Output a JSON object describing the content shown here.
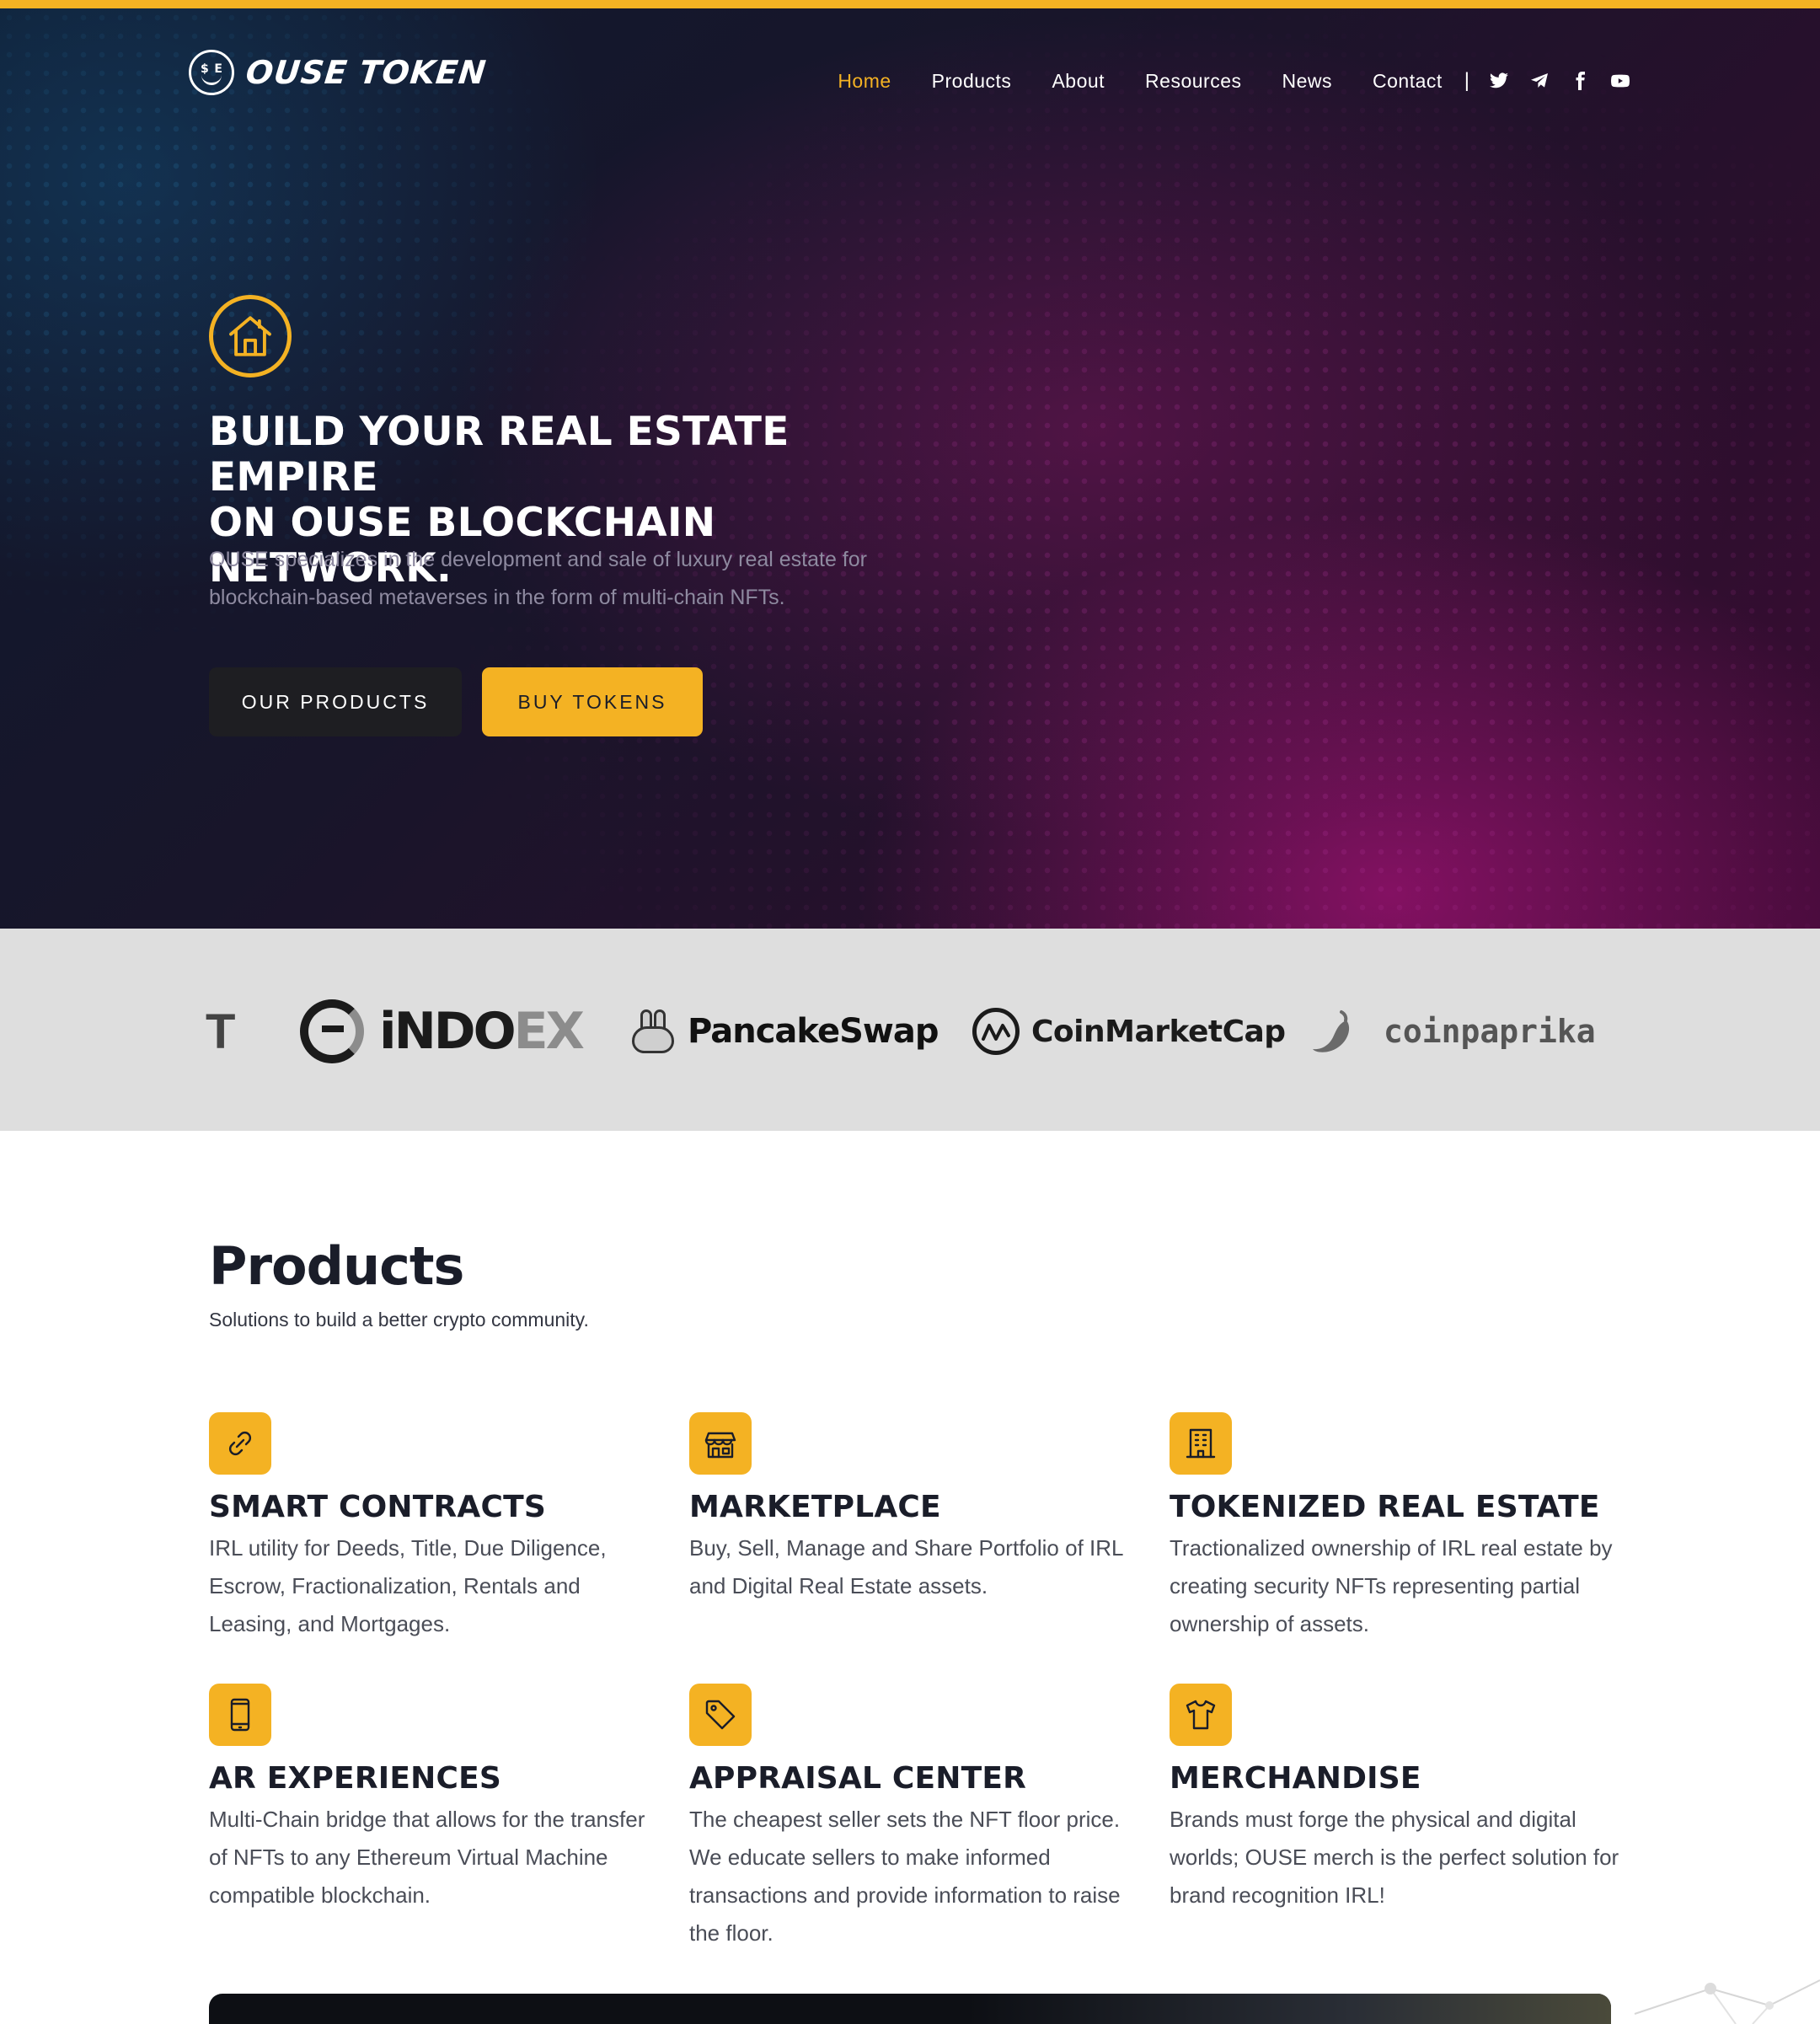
{
  "brand": {
    "logo_text": "OUSE TOKEN",
    "logo_letters": [
      "$",
      "E"
    ],
    "accent": "#f4b223"
  },
  "nav": {
    "items": [
      {
        "label": "Home",
        "active": true
      },
      {
        "label": "Products",
        "active": false
      },
      {
        "label": "About",
        "active": false
      },
      {
        "label": "Resources",
        "active": false
      },
      {
        "label": "News",
        "active": false
      },
      {
        "label": "Contact",
        "active": false
      }
    ],
    "separator": "|",
    "social": [
      "twitter-icon",
      "telegram-icon",
      "facebook-icon",
      "youtube-icon"
    ]
  },
  "hero": {
    "icon": "house-icon",
    "title_line1": "BUILD YOUR REAL ESTATE EMPIRE",
    "title_line2": "ON OUSE BLOCKCHAIN NETWORK.",
    "description": "OUSE specializes in the development and sale of luxury real estate for blockchain-based metaverses in the form of multi-chain NFTs.",
    "primary_button": "OUR PRODUCTS",
    "secondary_button": "BUY TOKENS"
  },
  "partners": {
    "cut_text": "T",
    "items": [
      {
        "name": "indoex-logo",
        "text_dark": "iNDO",
        "text_light": "EX"
      },
      {
        "name": "pancakeswap-logo",
        "text": "PancakeSwap"
      },
      {
        "name": "coinmarketcap-logo",
        "text": "CoinMarketCap"
      },
      {
        "name": "coinpaprika-logo",
        "text": "coinpaprika"
      }
    ]
  },
  "products": {
    "title": "Products",
    "subtitle": "Solutions to build a better crypto community.",
    "cards": [
      {
        "icon": "link-icon",
        "title": "SMART CONTRACTS",
        "text": "IRL utility for Deeds, Title, Due Diligence, Escrow, Fractionalization, Rentals and Leasing, and Mortgages."
      },
      {
        "icon": "store-icon",
        "title": "MARKETPLACE",
        "text": "Buy, Sell, Manage and Share Portfolio of IRL and Digital Real Estate assets."
      },
      {
        "icon": "building-icon",
        "title": "TOKENIZED REAL ESTATE",
        "text": "Tractionalized ownership of IRL real estate by creating security NFTs representing partial ownership of assets."
      },
      {
        "icon": "phone-icon",
        "title": "AR EXPERIENCES",
        "text": "Multi-Chain bridge that allows for the transfer of NFTs to any Ethereum Virtual Machine compatible blockchain."
      },
      {
        "icon": "tag-icon",
        "title": "APPRAISAL CENTER",
        "text": "The cheapest seller sets the NFT floor price. We educate sellers to make informed transactions and provide information to raise the floor."
      },
      {
        "icon": "shirt-icon",
        "title": "MERCHANDISE",
        "text": "Brands must forge the physical and digital worlds; OUSE merch is the perfect solution for brand recognition IRL!"
      }
    ]
  }
}
